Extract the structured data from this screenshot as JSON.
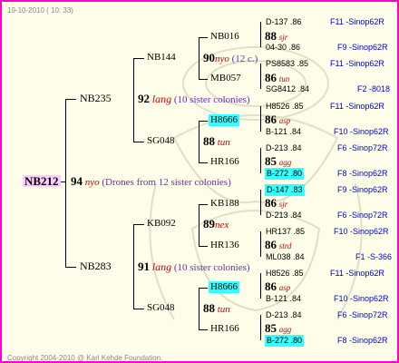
{
  "date": "19-10-2010 ( 10: 33)",
  "copyright": "Copyright 2004-2010 @ Karl Kehde Foundation.",
  "root": {
    "id": "NB212",
    "num": "94",
    "race": "nyo",
    "note": "(Drones from 12 sister colonies)"
  },
  "gen1": [
    {
      "id": "NB235",
      "num": "92",
      "race": "lang",
      "note": "(10 sister colonies)"
    },
    {
      "id": "NB283",
      "num": "91",
      "race": "lang",
      "note": "(10 sister colonies)"
    }
  ],
  "gen2": [
    {
      "id": "NB144",
      "num": "90",
      "race": "nyo",
      "note": "(12 c.)"
    },
    {
      "id": "SG048",
      "num": "88",
      "race": "tun"
    },
    {
      "id": "KB092",
      "num": "89",
      "race": "nex"
    },
    {
      "id": "SG048",
      "num": "88",
      "race": "tun"
    }
  ],
  "gen3": [
    {
      "id": "NB016",
      "num": "88",
      "race": "sjr"
    },
    {
      "id": "MB057",
      "num": "86",
      "race": "tun"
    },
    {
      "id": "H8666",
      "num": "86",
      "race": "asp"
    },
    {
      "id": "HR166",
      "num": "85",
      "race": "agg"
    },
    {
      "id": "KB188",
      "num": "86",
      "race": "sjr"
    },
    {
      "id": "HR136",
      "num": "86",
      "race": "strd"
    },
    {
      "id": "H8666",
      "num": "86",
      "race": "asp"
    },
    {
      "id": "HR166",
      "num": "85",
      "race": "agg"
    }
  ],
  "gen4": [
    {
      "left": "D-137 .86",
      "right": "F11 -Sinop62R"
    },
    {
      "left": "04-30 .86",
      "right": "F9 -Sinop62R"
    },
    {
      "left": "PS8583 .85",
      "right": "F11 -Sinop62R"
    },
    {
      "left": "SG8412 .84",
      "right": "F2 -8018"
    },
    {
      "left": "H8526 .85",
      "right": "F11 -Sinop62R"
    },
    {
      "left": "B-121 .84",
      "right": "F10 -Sinop62R"
    },
    {
      "left": "D-213 .84",
      "right": "F6 -Sinop72R"
    },
    {
      "left": "B-272 .80",
      "right": "F8 -Sinop62R"
    },
    {
      "left": "D-147 .83",
      "right": "F9 -Sinop62R"
    },
    {
      "left": "D-213 .84",
      "right": "F6 -Sinop72R"
    },
    {
      "left": "HR137 .85",
      "right": "F10 -Sinop62R"
    },
    {
      "left": "ML038 .84",
      "right": "F1 -S-366"
    },
    {
      "left": "H8526 .85",
      "right": "F11 -Sinop62R"
    },
    {
      "left": "B-121 .84",
      "right": "F10 -Sinop62R"
    },
    {
      "left": "D-213 .84",
      "right": "F6 -Sinop72R"
    },
    {
      "left": "B-272 .80",
      "right": "F8 -Sinop62R"
    }
  ]
}
